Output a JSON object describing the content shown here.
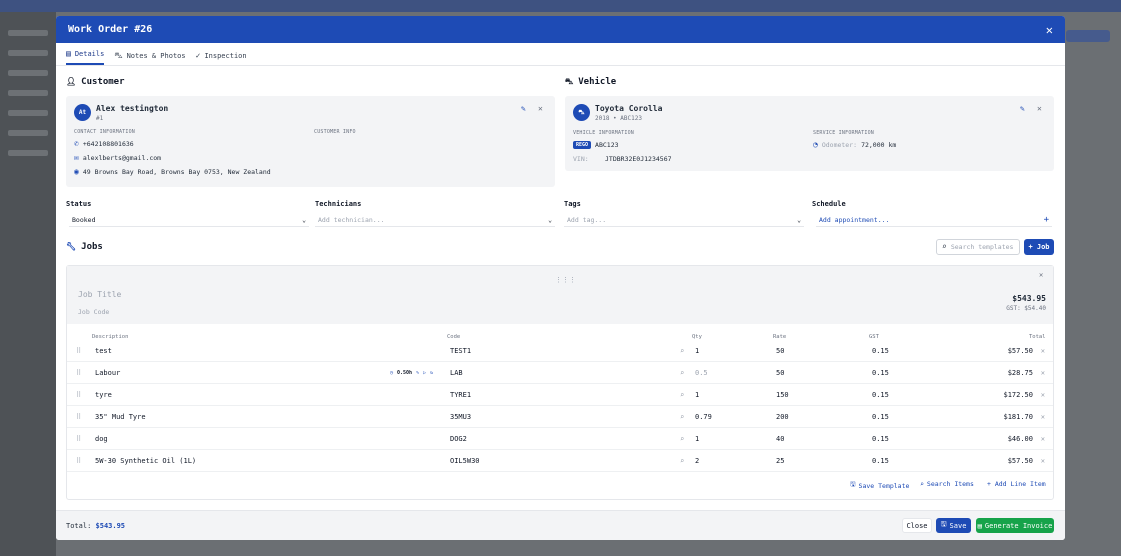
{
  "modal": {
    "title": "Work Order #26"
  },
  "tabs": [
    {
      "label": "Details"
    },
    {
      "label": "Notes & Photos"
    },
    {
      "label": "Inspection"
    }
  ],
  "customer": {
    "section_title": "Customer",
    "initials": "At",
    "name": "Alex testington",
    "number": "#1",
    "contact_label": "CONTACT INFORMATION",
    "info_label": "CUSTOMER INFO",
    "phone": "+642108801636",
    "email": "alexlberts@gmail.com",
    "address": "49 Browns Bay Road, Browns Bay 0753, New Zealand"
  },
  "vehicle": {
    "section_title": "Vehicle",
    "name": "Toyota Corolla",
    "sub": "2018 • ABC123",
    "info_label": "VEHICLE INFORMATION",
    "service_label": "SERVICE INFORMATION",
    "rego_badge": "REGO",
    "rego": "ABC123",
    "vin_label": "VIN:",
    "vin": "JTDBR32E0J1234567",
    "odometer_label": "Odometer:",
    "odometer": "72,000 km"
  },
  "fields": {
    "status_label": "Status",
    "status_value": "Booked",
    "tech_label": "Technicians",
    "tech_placeholder": "Add technician...",
    "tags_label": "Tags",
    "tags_placeholder": "Add tag...",
    "schedule_label": "Schedule",
    "schedule_placeholder": "Add appointment..."
  },
  "jobs": {
    "section_title": "Jobs",
    "search_placeholder": "Search templates",
    "add_job": "+ Job",
    "job_title_placeholder": "Job Title",
    "job_code_placeholder": "Job Code",
    "job_total": "$543.95",
    "job_gst": "GST: $54.40",
    "headers": {
      "description": "Description",
      "code": "Code",
      "qty": "Qty",
      "rate": "Rate",
      "gst": "GST",
      "total": "Total"
    },
    "rows": [
      {
        "description": "test",
        "code": "TEST1",
        "qty": "1",
        "rate": "50",
        "gst": "0.15",
        "total": "$57.50",
        "qty_muted": false
      },
      {
        "description": "Labour",
        "code": "LAB",
        "qty": "0.5",
        "rate": "50",
        "gst": "0.15",
        "total": "$28.75",
        "qty_muted": true,
        "timer": "0.50h"
      },
      {
        "description": "tyre",
        "code": "TYRE1",
        "qty": "1",
        "rate": "150",
        "gst": "0.15",
        "total": "$172.50",
        "qty_muted": false
      },
      {
        "description": "35\" Mud Tyre",
        "code": "35MU3",
        "qty": "0.79",
        "rate": "200",
        "gst": "0.15",
        "total": "$181.70",
        "qty_muted": false
      },
      {
        "description": "dog",
        "code": "DOG2",
        "qty": "1",
        "rate": "40",
        "gst": "0.15",
        "total": "$46.00",
        "qty_muted": false
      },
      {
        "description": "5W-30 Synthetic Oil (1L)",
        "code": "OIL5W30",
        "qty": "2",
        "rate": "25",
        "gst": "0.15",
        "total": "$57.50",
        "qty_muted": false
      }
    ],
    "save_template": "Save Template",
    "search_items": "Search Items",
    "add_line_item": "+ Add Line Item"
  },
  "footer": {
    "total_label": "Total:",
    "total_value": "$543.95",
    "close": "Close",
    "save": "Save",
    "generate_invoice": "Generate Invoice"
  }
}
